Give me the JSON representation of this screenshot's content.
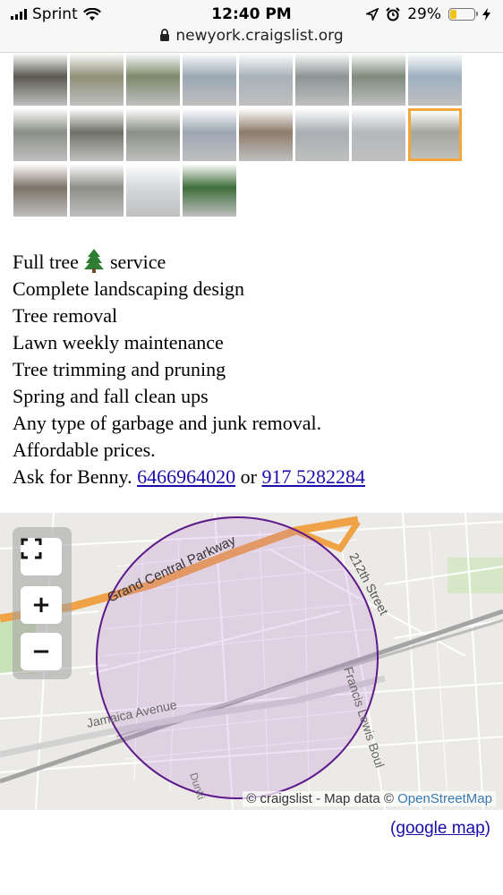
{
  "status_bar": {
    "carrier": "Sprint",
    "time": "12:40 PM",
    "battery_percent": "29%",
    "battery_level": 0.29
  },
  "url_bar": {
    "url": "newyork.craigslist.org"
  },
  "gallery": {
    "selected_index": 15,
    "thumbnail_colors": [
      "#5a5a50",
      "#8f9178",
      "#7c8a6c",
      "#9aa8b4",
      "#a8b2b8",
      "#8e9494",
      "#7f8b7d",
      "#9fb0c0",
      "#8c8f88",
      "#6f7268",
      "#8c9086",
      "#9ca6b3",
      "#8e7c6a",
      "#a9aeb2",
      "#b5b8bc",
      "#a3a69c",
      "#7d7468",
      "#8d8e88",
      "#d6d8dc",
      "#3f6e3c"
    ]
  },
  "description": {
    "line1_before": "Full tree",
    "line1_after": "service",
    "lines": [
      "Complete landscaping design",
      "Tree removal",
      "Lawn weekly maintenance",
      "Tree trimming and pruning",
      "Spring and fall clean ups",
      "Any type of garbage and junk removal.",
      "Affordable prices."
    ],
    "contact_prefix": "Ask for Benny.",
    "phone1": "6466964020",
    "contact_or": "or",
    "phone2": "917 5282284"
  },
  "map": {
    "labels": {
      "parkway": "Grand Central Parkway",
      "street": "212th Street",
      "avenue": "Jamaica Avenue",
      "blvd": "Francis Lewis Boul",
      "small": "Dunki"
    },
    "zoom_in": "+",
    "zoom_out": "−",
    "attribution_prefix": "© craigslist - Map data ©",
    "attribution_link": "OpenStreetMap"
  },
  "google_map": {
    "open": "(",
    "link": "google map",
    "close": ")"
  }
}
